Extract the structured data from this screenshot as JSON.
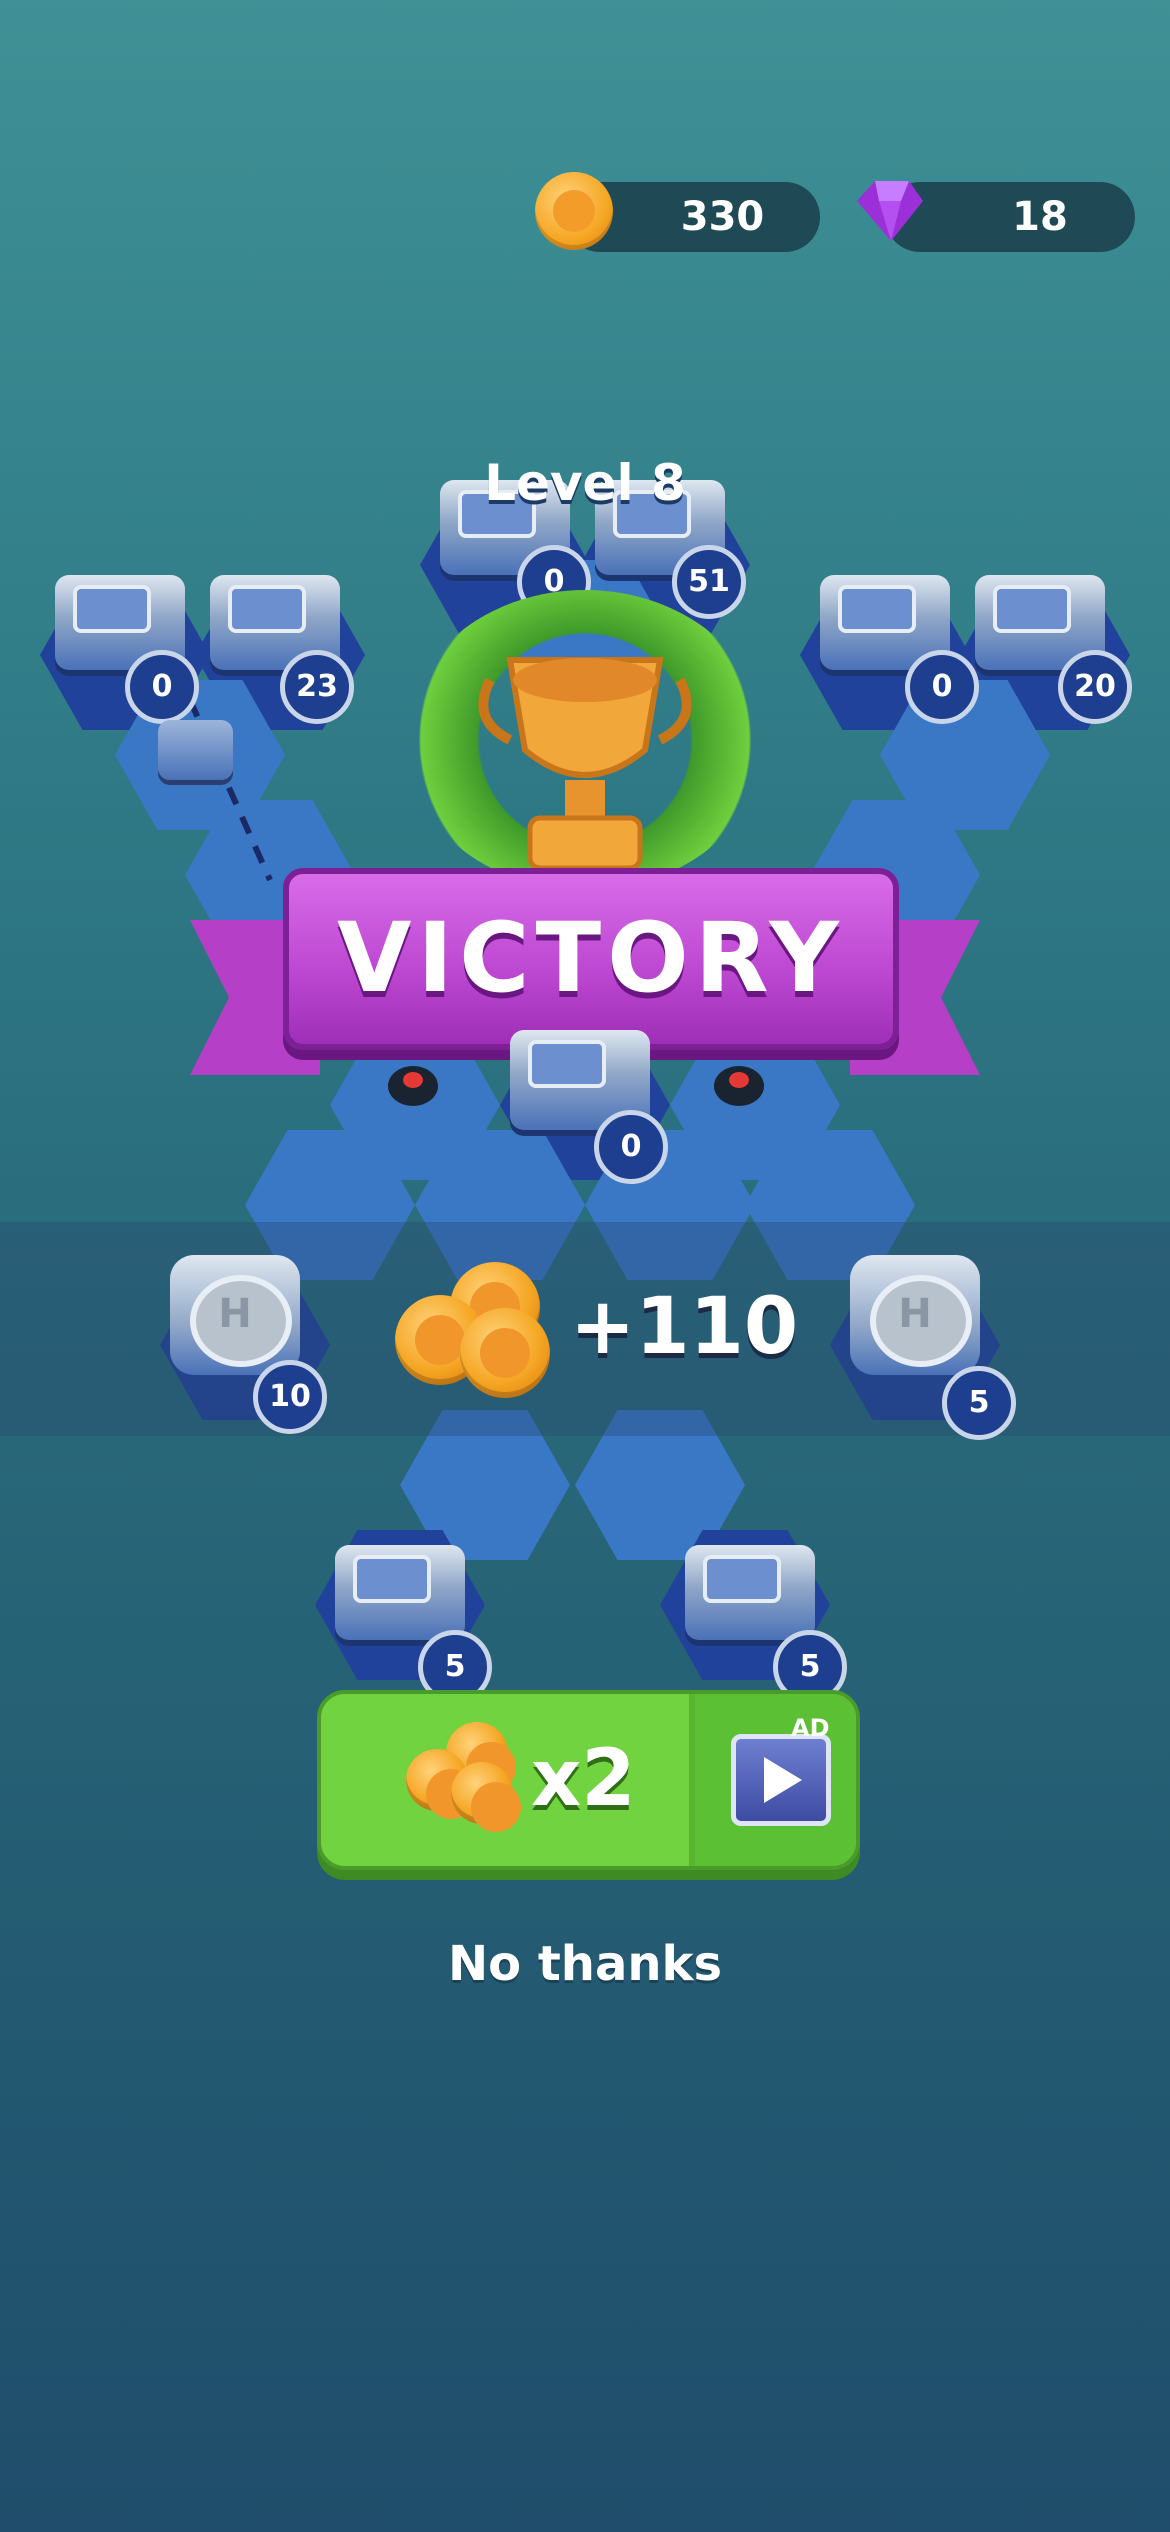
{
  "currency": {
    "coins": "330",
    "gems": "18"
  },
  "level_label": "Level 8",
  "banner": {
    "text": "VICTORY"
  },
  "reward": {
    "amount": "+110"
  },
  "map": {
    "badges": [
      "0",
      "51",
      "0",
      "23",
      "0",
      "20",
      "0",
      "10",
      "5",
      "5",
      "5"
    ],
    "helipad_letter": "H"
  },
  "double_button": {
    "multiplier": "x2",
    "ad_label": "AD"
  },
  "no_thanks": "No thanks",
  "colors": {
    "victory_banner": "#bb46d0",
    "double_button": "#72d341",
    "coin": "#f5a623",
    "gem": "#9b30d9",
    "hex_blue": "#3a78c6"
  }
}
